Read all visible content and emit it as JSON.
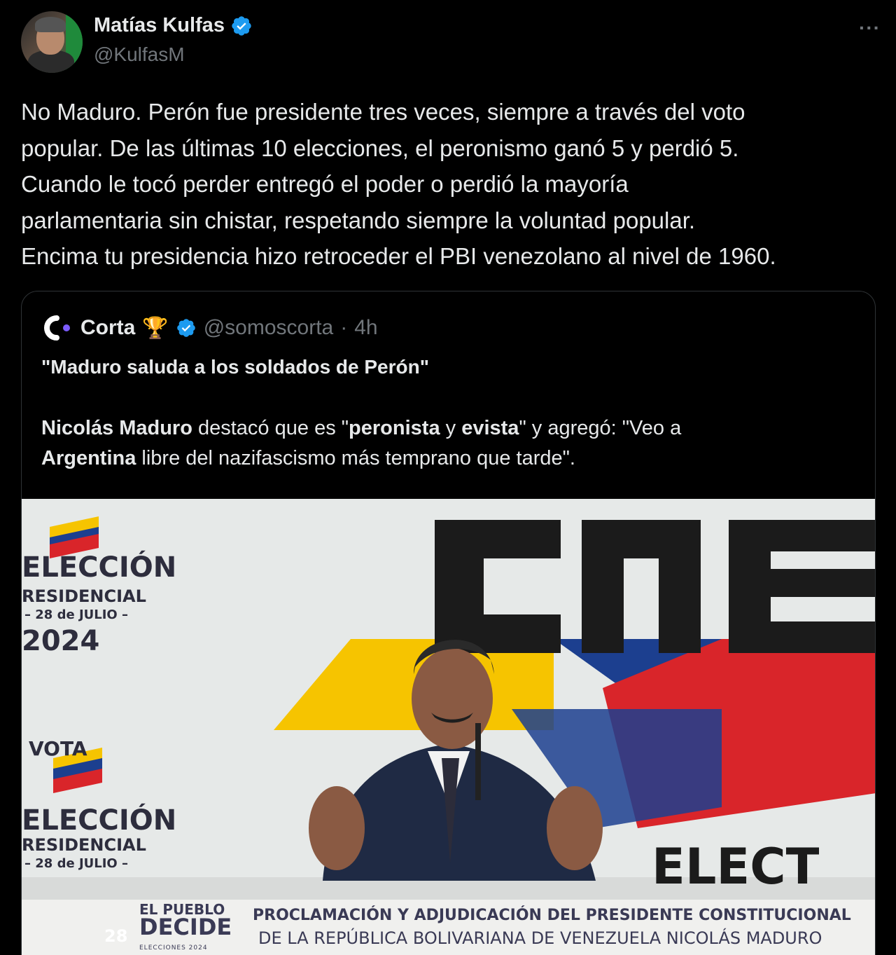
{
  "author": {
    "name": "Matías Kulfas",
    "handle": "@KulfasM",
    "verified": true
  },
  "more_label": "···",
  "tweet_lines": [
    "No Maduro. Perón fue presidente tres veces, siempre a través del voto",
    "popular. De las últimas 10 elecciones, el peronismo ganó 5 y perdió 5.",
    "Cuando le tocó perder entregó el poder o perdió la mayoría",
    "parlamentaria sin chistar, respetando siempre la voluntad popular.",
    "Encima tu presidencia hizo retroceder el PBI venezolano al nivel de 1960."
  ],
  "quote": {
    "name": "Corta",
    "trophy": "🏆",
    "handle": "@somoscorta",
    "separator": "·",
    "time": "4h",
    "title": "\"Maduro saluda a los soldados de Perón\"",
    "body_line1": {
      "p1": "Nicolás Maduro",
      "p2": " destacó que es \"",
      "p3": "peronista",
      "p4": " y ",
      "p5": "evista",
      "p6": "\" y agregó: \"Veo a"
    },
    "body_line2": {
      "p1": "Argentina",
      "p2": " libre del nazifascismo más temprano que tarde\"."
    }
  },
  "media": {
    "left_signs": {
      "eleccion": "ELECCIÓN",
      "residencial": "RESIDENCIAL",
      "date": "– 28 de JULIO –",
      "year": "2024",
      "vota": "VOTA"
    },
    "cne": "CNE",
    "elect": "ELECT",
    "pueblo_line1": "EL PUEBLO",
    "pueblo_line2": "DECIDE",
    "pueblo_line3": "ELECCIONES 2024",
    "ballot_num": "28",
    "banner_line1": "PROCLAMACIÓN Y ADJUDICACIÓN DEL PRESIDENTE CONSTITUCIONAL",
    "banner_line2": "DE LA REPÚBLICA BOLIVARIANA DE VENEZUELA NICOLÁS MADURO"
  },
  "colors": {
    "background": "#000000",
    "text": "#e7e9ea",
    "secondary": "#71767b",
    "verified_blue": "#1d9bf0",
    "border": "#2f3336",
    "cne_yellow": "#f6c400",
    "cne_blue": "#1c3f8f",
    "cne_red": "#d9252a"
  }
}
